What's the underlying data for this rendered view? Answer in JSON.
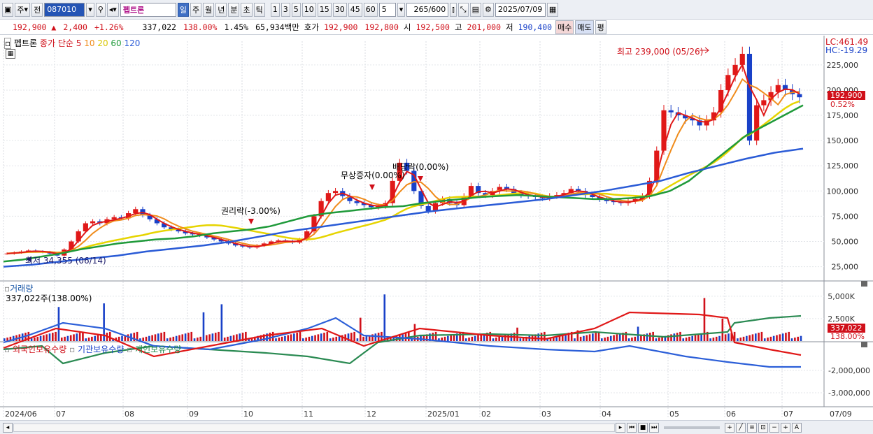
{
  "toolbar": {
    "menu_label": "주",
    "mode_label": "전",
    "stock_code": "087010",
    "stock_name": "펩트론",
    "periods": [
      "일",
      "주",
      "월",
      "년",
      "분",
      "초",
      "틱"
    ],
    "selected_period": "일",
    "intervals": [
      "1",
      "3",
      "5",
      "10",
      "15",
      "30",
      "45",
      "60"
    ],
    "interval_value": "5",
    "count_value": "265",
    "count_total": "/600",
    "date_value": "2025/07/09"
  },
  "quote": {
    "price": "192,900",
    "change_arrow": "▲",
    "change": "2,400",
    "change_pct": "+1.26%",
    "volume": "337,022",
    "volume_ratio": "138.00%",
    "turnover_pct": "1.45%",
    "amount": "65,934백만",
    "ask_label": "호가",
    "ask": "192,900",
    "bid": "192,800",
    "open_label": "시",
    "open": "192,500",
    "high_label": "고",
    "high": "201,000",
    "low_label": "저",
    "low": "190,400",
    "buy_label": "매수",
    "sell_label": "매도",
    "eval_label": "평"
  },
  "price_panel": {
    "legend_name": "펩트론",
    "legend_ma_title": "종가 단순",
    "ma_periods": [
      "5",
      "10",
      "20",
      "60",
      "120"
    ],
    "ma_colors": [
      "#e01818",
      "#f08c1c",
      "#e6d400",
      "#1f9a3a",
      "#2a5bd6"
    ],
    "lc_label": "LC:461.49",
    "hc_label": "HC:-19.29",
    "high_annotation": "최고 239,000 (05/26)",
    "low_annotation": "최저 34,355 (06/14)",
    "event_rights": "권리락(-3.00%)",
    "event_bonus": "무상증자(0.00%)",
    "event_dividend": "배당락(0.00%)",
    "current_price_tag": "192,900",
    "current_pct_tag": "0.52%",
    "y_ticks": [
      "225,000",
      "200,000",
      "175,000",
      "150,000",
      "125,000",
      "100,000",
      "75,000",
      "50,000",
      "25,000"
    ]
  },
  "volume_panel": {
    "title": "거래량",
    "value_label": "337,022주(138.00%)",
    "y_ticks": [
      "5,000K",
      "2,500K"
    ],
    "current_tag": "337,022",
    "current_pct": "138.00%"
  },
  "holding_panel": {
    "legend": [
      "외국인보유수량",
      "기관보유수량",
      "개인보유수량"
    ],
    "y_ticks": [
      "-2,000,000",
      "-3,000,000"
    ]
  },
  "x_axis": {
    "labels": [
      "2024/06",
      "07",
      "08",
      "09",
      "10",
      "11",
      "12",
      "2025/01",
      "02",
      "03",
      "04",
      "05",
      "06",
      "07"
    ],
    "end_label": "07/09"
  },
  "chart_data": {
    "type": "candlestick",
    "price_ylim": [
      15000,
      245000
    ],
    "close_approx": [
      38000,
      39000,
      40000,
      41000,
      40000,
      39500,
      38000,
      36000,
      42000,
      50000,
      60000,
      68000,
      70000,
      68000,
      72000,
      74000,
      73000,
      78000,
      82000,
      76000,
      72000,
      68000,
      64000,
      62000,
      60000,
      58000,
      57000,
      56000,
      54000,
      52000,
      50000,
      48000,
      46000,
      45000,
      44000,
      46000,
      48000,
      50000,
      51000,
      50000,
      49000,
      52000,
      60000,
      75000,
      90000,
      98000,
      100000,
      95000,
      90000,
      88000,
      86000,
      84000,
      85000,
      88000,
      110000,
      128000,
      120000,
      100000,
      85000,
      80000,
      88000,
      92000,
      88000,
      86000,
      95000,
      105000,
      98000,
      96000,
      100000,
      104000,
      102000,
      98000,
      96000,
      95000,
      94000,
      93000,
      95000,
      96000,
      98000,
      102000,
      100000,
      96000,
      94000,
      92000,
      90000,
      89000,
      88000,
      90000,
      92000,
      95000,
      110000,
      140000,
      180000,
      178000,
      175000,
      172000,
      170000,
      165000,
      170000,
      178000,
      200000,
      215000,
      225000,
      236000,
      150000,
      185000,
      190000,
      198000,
      205000,
      200000,
      196000,
      192900
    ],
    "ma60_approx": [
      30000,
      32000,
      35000,
      38000,
      42000,
      45000,
      48000,
      50000,
      52000,
      53000,
      55000,
      58000,
      60000,
      62000,
      65000,
      70000,
      75000,
      78000,
      80000,
      82000,
      84000,
      85000,
      88000,
      90000,
      92000,
      94000,
      95000,
      96000,
      95000,
      94000,
      93000,
      92000,
      92000,
      93000,
      95000,
      100000,
      110000,
      125000,
      140000,
      155000,
      165000,
      175000,
      185000
    ],
    "ma120_approx": [
      25000,
      27000,
      30000,
      33000,
      36000,
      40000,
      43000,
      46000,
      50000,
      55000,
      60000,
      64000,
      68000,
      72000,
      76000,
      80000,
      83000,
      86000,
      89000,
      92000,
      96000,
      100000,
      105000,
      110000,
      118000,
      125000,
      132000,
      138000,
      142000
    ],
    "volume_note": "volume bars in K shares; peak about 5,000K in late Nov 2024 and early Jun 2025"
  }
}
